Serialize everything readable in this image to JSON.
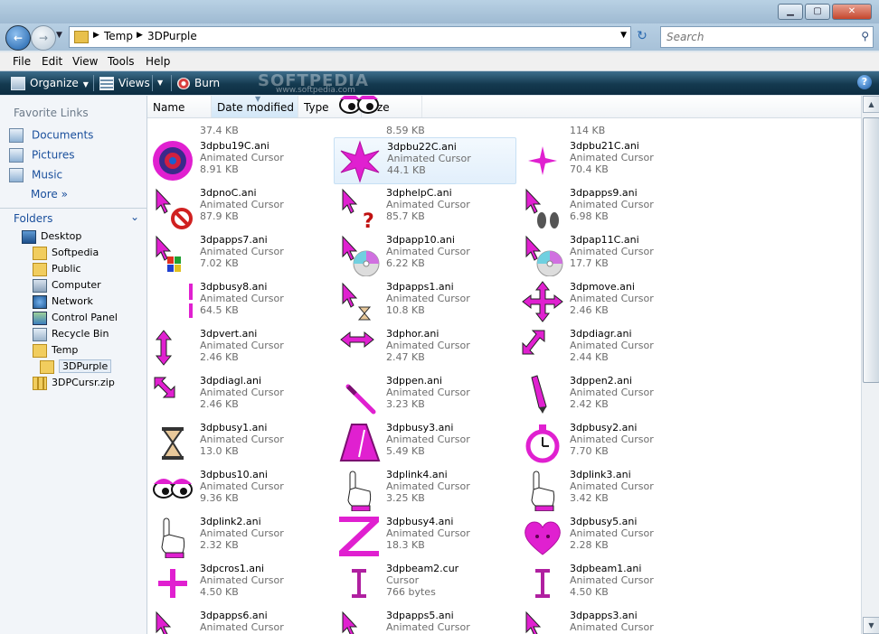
{
  "window": {
    "buttons": [
      "▁",
      "▢",
      "✕"
    ]
  },
  "address": {
    "segments": [
      "Temp",
      "3DPurple"
    ],
    "search_placeholder": "Search"
  },
  "menu": [
    "File",
    "Edit",
    "View",
    "Tools",
    "Help"
  ],
  "toolbar": {
    "organize": "Organize",
    "views": "Views",
    "burn": "Burn",
    "watermark": "SOFTPEDIA",
    "watermark_url": "www.softpedia.com"
  },
  "nav": {
    "favorites_header": "Favorite Links",
    "favorites": [
      "Documents",
      "Pictures",
      "Music"
    ],
    "more": "More",
    "folders_header": "Folders",
    "tree": [
      {
        "label": "Desktop",
        "icon": "desktop-icon"
      },
      {
        "label": "Softpedia",
        "icon": "user-folder-icon"
      },
      {
        "label": "Public",
        "icon": "folder-icon"
      },
      {
        "label": "Computer",
        "icon": "computer-icon"
      },
      {
        "label": "Network",
        "icon": "network-icon"
      },
      {
        "label": "Control Panel",
        "icon": "control-panel-icon"
      },
      {
        "label": "Recycle Bin",
        "icon": "recycle-bin-icon"
      },
      {
        "label": "Temp",
        "icon": "folder-icon"
      },
      {
        "label": "3DPurple",
        "icon": "folder-icon"
      },
      {
        "label": "3DPCursr.zip",
        "icon": "zip-folder-icon"
      }
    ]
  },
  "columns": [
    "Name",
    "Date modified",
    "Type",
    "Size"
  ],
  "files": [
    {
      "name": "",
      "type": "",
      "size": "37.4 KB",
      "icon": "dot-cursor"
    },
    {
      "name": "",
      "type": "",
      "size": "8.59 KB",
      "icon": "eyes-cursor"
    },
    {
      "name": "",
      "type": "",
      "size": "114 KB",
      "icon": "blank-cursor"
    },
    {
      "name": "3dpbu19C.ani",
      "type": "Animated Cursor",
      "size": "8.91 KB",
      "icon": "ring-cursor"
    },
    {
      "name": "3dpbu22C.ani",
      "type": "Animated Cursor",
      "size": "44.1 KB",
      "icon": "star-cursor"
    },
    {
      "name": "3dpbu21C.ani",
      "type": "Animated Cursor",
      "size": "70.4 KB",
      "icon": "sparkle-cursor"
    },
    {
      "name": "3dpnoC.ani",
      "type": "Animated Cursor",
      "size": "87.9 KB",
      "icon": "no-cursor"
    },
    {
      "name": "3dphelpC.ani",
      "type": "Animated Cursor",
      "size": "85.7 KB",
      "icon": "help-cursor"
    },
    {
      "name": "3dpapps9.ani",
      "type": "Animated Cursor",
      "size": "6.98 KB",
      "icon": "footprints-cursor"
    },
    {
      "name": "3dpapps7.ani",
      "type": "Animated Cursor",
      "size": "7.02 KB",
      "icon": "flag-cursor"
    },
    {
      "name": "3dpapp10.ani",
      "type": "Animated Cursor",
      "size": "6.22 KB",
      "icon": "cd-cursor"
    },
    {
      "name": "3dpap11C.ani",
      "type": "Animated Cursor",
      "size": "17.7 KB",
      "icon": "cd-cursor"
    },
    {
      "name": "3dpbusy8.ani",
      "type": "Animated Cursor",
      "size": "64.5 KB",
      "icon": "bars-cursor"
    },
    {
      "name": "3dpapps1.ani",
      "type": "Animated Cursor",
      "size": "10.8 KB",
      "icon": "hourglass-arrow-cursor"
    },
    {
      "name": "3dpmove.ani",
      "type": "Animated Cursor",
      "size": "2.46 KB",
      "icon": "move-cursor"
    },
    {
      "name": "3dpvert.ani",
      "type": "Animated Cursor",
      "size": "2.46 KB",
      "icon": "vertical-resize-cursor"
    },
    {
      "name": "3dphor.ani",
      "type": "Animated Cursor",
      "size": "2.47 KB",
      "icon": "horizontal-resize-cursor"
    },
    {
      "name": "3dpdiagr.ani",
      "type": "Animated Cursor",
      "size": "2.44 KB",
      "icon": "diagonal-right-cursor"
    },
    {
      "name": "3dpdiagl.ani",
      "type": "Animated Cursor",
      "size": "2.46 KB",
      "icon": "diagonal-left-cursor"
    },
    {
      "name": "3dppen.ani",
      "type": "Animated Cursor",
      "size": "3.23 KB",
      "icon": "pen-cursor"
    },
    {
      "name": "3dppen2.ani",
      "type": "Animated Cursor",
      "size": "2.42 KB",
      "icon": "pencil-cursor"
    },
    {
      "name": "3dpbusy1.ani",
      "type": "Animated Cursor",
      "size": "13.0 KB",
      "icon": "hourglass-cursor"
    },
    {
      "name": "3dpbusy3.ani",
      "type": "Animated Cursor",
      "size": "5.49 KB",
      "icon": "metronome-cursor"
    },
    {
      "name": "3dpbusy2.ani",
      "type": "Animated Cursor",
      "size": "7.70 KB",
      "icon": "stopwatch-cursor"
    },
    {
      "name": "3dpbus10.ani",
      "type": "Animated Cursor",
      "size": "9.36 KB",
      "icon": "eyes-cursor"
    },
    {
      "name": "3dplink4.ani",
      "type": "Animated Cursor",
      "size": "3.25 KB",
      "icon": "hand-cursor"
    },
    {
      "name": "3dplink3.ani",
      "type": "Animated Cursor",
      "size": "3.42 KB",
      "icon": "hand-cursor"
    },
    {
      "name": "3dplink2.ani",
      "type": "Animated Cursor",
      "size": "2.32 KB",
      "icon": "hand-cursor"
    },
    {
      "name": "3dpbusy4.ani",
      "type": "Animated Cursor",
      "size": "18.3 KB",
      "icon": "z-cursor"
    },
    {
      "name": "3dpbusy5.ani",
      "type": "Animated Cursor",
      "size": "2.28 KB",
      "icon": "heart-cursor"
    },
    {
      "name": "3dpcros1.ani",
      "type": "Animated Cursor",
      "size": "4.50 KB",
      "icon": "cross-cursor"
    },
    {
      "name": "3dpbeam2.cur",
      "type": "Cursor",
      "size": "766 bytes",
      "icon": "ibeam-cursor"
    },
    {
      "name": "3dpbeam1.ani",
      "type": "Animated Cursor",
      "size": "4.50 KB",
      "icon": "ibeam-cursor"
    },
    {
      "name": "3dpapps6.ani",
      "type": "Animated Cursor",
      "size": "",
      "icon": "arrow-cursor"
    },
    {
      "name": "3dpapps5.ani",
      "type": "Animated Cursor",
      "size": "",
      "icon": "arrow-cursor"
    },
    {
      "name": "3dpapps3.ani",
      "type": "Animated Cursor",
      "size": "",
      "icon": "arrow-cursor"
    }
  ],
  "colors": {
    "accent": "#e020d0",
    "link": "#1a4f9c",
    "toolbar": "#14394f"
  }
}
